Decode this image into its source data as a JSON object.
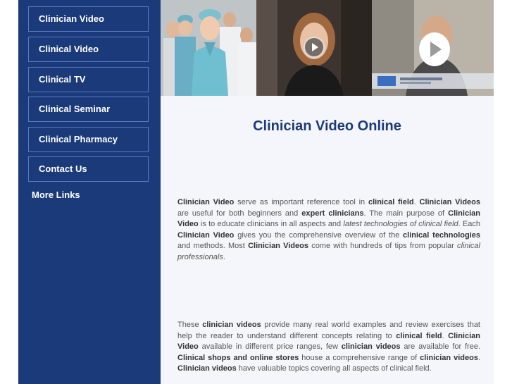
{
  "sidebar": {
    "items": [
      {
        "label": "Clinician Video"
      },
      {
        "label": "Clinical Video"
      },
      {
        "label": "Clinical TV"
      },
      {
        "label": "Clinical Seminar"
      },
      {
        "label": "Clinical Pharmacy"
      },
      {
        "label": "Contact Us"
      }
    ],
    "more_links": "More Links"
  },
  "main": {
    "title": "Clinician Video Online",
    "paragraph1": [
      {
        "t": "Clinician Video",
        "s": "b"
      },
      {
        "t": " serve as important reference tool in "
      },
      {
        "t": "clinical field",
        "s": "b"
      },
      {
        "t": ". "
      },
      {
        "t": "Clinician Videos",
        "s": "b"
      },
      {
        "t": " are useful for both beginners and "
      },
      {
        "t": "expert clinicians",
        "s": "b"
      },
      {
        "t": ". The main purpose of "
      },
      {
        "t": "Clinician Video",
        "s": "b"
      },
      {
        "t": " is to educate clinicians in all aspects and "
      },
      {
        "t": "latest technologies of clinical field",
        "s": "i"
      },
      {
        "t": ". Each "
      },
      {
        "t": "Clinician Video",
        "s": "b"
      },
      {
        "t": " gives you the comprehensive overview of the "
      },
      {
        "t": "clinical technologies",
        "s": "b"
      },
      {
        "t": " and methods. Most "
      },
      {
        "t": "Clinician Videos",
        "s": "b"
      },
      {
        "t": " come with hundreds of tips from popular "
      },
      {
        "t": "clinical professionals",
        "s": "i"
      },
      {
        "t": "."
      }
    ],
    "paragraph2": [
      {
        "t": "These "
      },
      {
        "t": "clinician videos",
        "s": "b"
      },
      {
        "t": " provide many real world examples and review exercises that help the reader to understand different concepts relating to "
      },
      {
        "t": "clinical field",
        "s": "b"
      },
      {
        "t": ". "
      },
      {
        "t": "Clinician Video",
        "s": "b"
      },
      {
        "t": " available in different price ranges, few "
      },
      {
        "t": "clinician videos",
        "s": "b"
      },
      {
        "t": " are available for free. "
      },
      {
        "t": "Clinical shops and online stores",
        "s": "b"
      },
      {
        "t": " house a comprehensive range of "
      },
      {
        "t": "clinician videos",
        "s": "b"
      },
      {
        "t": ". "
      },
      {
        "t": "Clinician videos",
        "s": "b"
      },
      {
        "t": " have valuable topics covering all aspects of clinical field."
      }
    ]
  },
  "colors": {
    "sidebar_bg": "#1b3a7a",
    "title": "#1b3a7a",
    "content_bg": "#f5f6fb"
  }
}
